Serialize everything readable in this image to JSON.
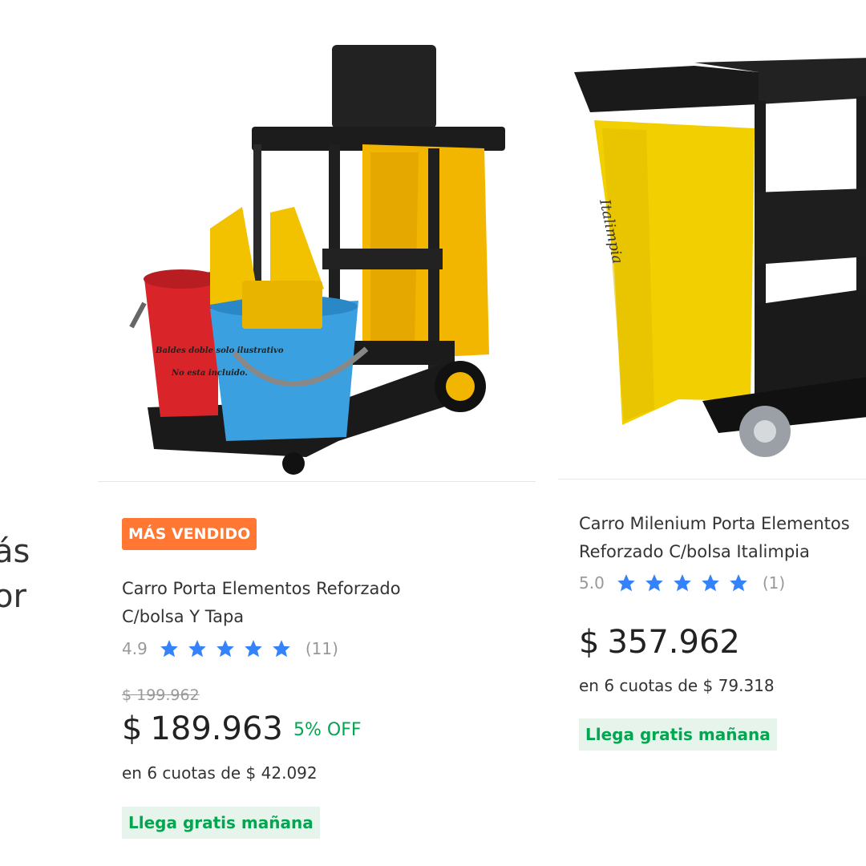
{
  "left_fragment": {
    "line1": "ás",
    "line2": "or"
  },
  "products": [
    {
      "badge": "MÁS VENDIDO",
      "image_alt": "Carro con baldes y bolsa amarilla",
      "image_overlay": [
        "Baldes doble solo ilustrativo",
        "No esta incluido."
      ],
      "title_line1": "Carro Porta Elementos Reforzado",
      "title_line2": "C/bolsa Y Tapa",
      "rating": "4.9",
      "stars": 5,
      "reviews": "(11)",
      "old_price": "$ 199.962",
      "currency": "$",
      "price": "189.963",
      "discount": "5% OFF",
      "installments": "en 6 cuotas de $ 42.092",
      "shipping": "Llega gratis mañana"
    },
    {
      "title_line1": "Carro Milenium Porta Elementos",
      "title_line2": "Reforzado C/bolsa Italimpia",
      "image_bag_text": "Italimpia",
      "rating": "5.0",
      "stars": 5,
      "reviews": "(1)",
      "currency": "$",
      "price": "357.962",
      "installments": "en 6 cuotas de $ 79.318",
      "shipping": "Llega gratis mañana"
    }
  ],
  "colors": {
    "badge_bg": "#ff7733",
    "star": "#3483fa",
    "green": "#00a650",
    "shipping_bg": "#e7f4ec"
  }
}
